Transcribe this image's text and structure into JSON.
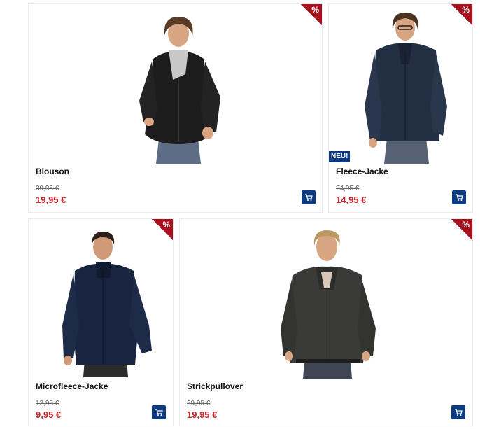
{
  "sale_badge": "%",
  "new_badge": "NEU!",
  "colors": {
    "sale_red": "#a8121f",
    "price_red": "#c9252b",
    "cart_blue": "#0d3a7e"
  },
  "products": [
    {
      "name": "Blouson",
      "old_price": "39,95 €",
      "new_price": "19,95 €",
      "image": "man-in-black-leather-jacket"
    },
    {
      "name": "Fleece-Jacke",
      "old_price": "24,95 €",
      "new_price": "14,95 €",
      "image": "man-in-navy-fleece-jacket"
    },
    {
      "name": "Microfleece-Jacke",
      "old_price": "12,95 €",
      "new_price": "9,95 €",
      "image": "man-in-navy-microfleece-jacket"
    },
    {
      "name": "Strickpullover",
      "old_price": "29,95 €",
      "new_price": "19,95 €",
      "image": "man-in-dark-knit-pullover"
    }
  ]
}
